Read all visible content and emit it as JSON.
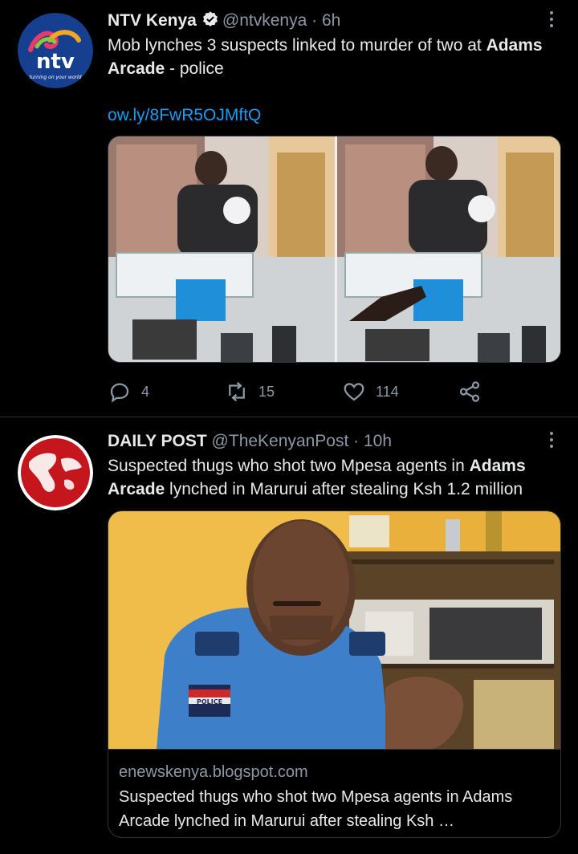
{
  "tweets": [
    {
      "author": "NTV Kenya",
      "handle": "@ntvkenya",
      "time": "6h",
      "avatar_logo": "ntv",
      "avatar_tagline": "turning on your world",
      "text_before": "Mob lynches 3 suspects linked to murder of two at ",
      "text_bold": "Adams Arcade",
      "text_after": " - police",
      "link": "ow.ly/8FwR5OJMftQ",
      "stats": {
        "replies": "4",
        "retweets": "15",
        "likes": "114"
      }
    },
    {
      "author": "DAILY POST",
      "handle": "@TheKenyanPost",
      "time": "10h",
      "text_a": "Suspected thugs who shot two Mpesa agents in ",
      "text_bold": "Adams Arcade",
      "text_after": " lynched in Marurui after stealing Ksh 1.2 million",
      "card_domain": "enewskenya.blogspot.com",
      "card_title": "Suspected thugs who shot two Mpesa agents in Adams Arcade lynched in Marurui after stealing Ksh …",
      "badge_text": "POLICE"
    }
  ],
  "separator": "·",
  "colors": {
    "link": "#1d9bf0",
    "muted": "#8b98a5",
    "text": "#e7e9ea",
    "ntv_blue": "#173f8f"
  }
}
